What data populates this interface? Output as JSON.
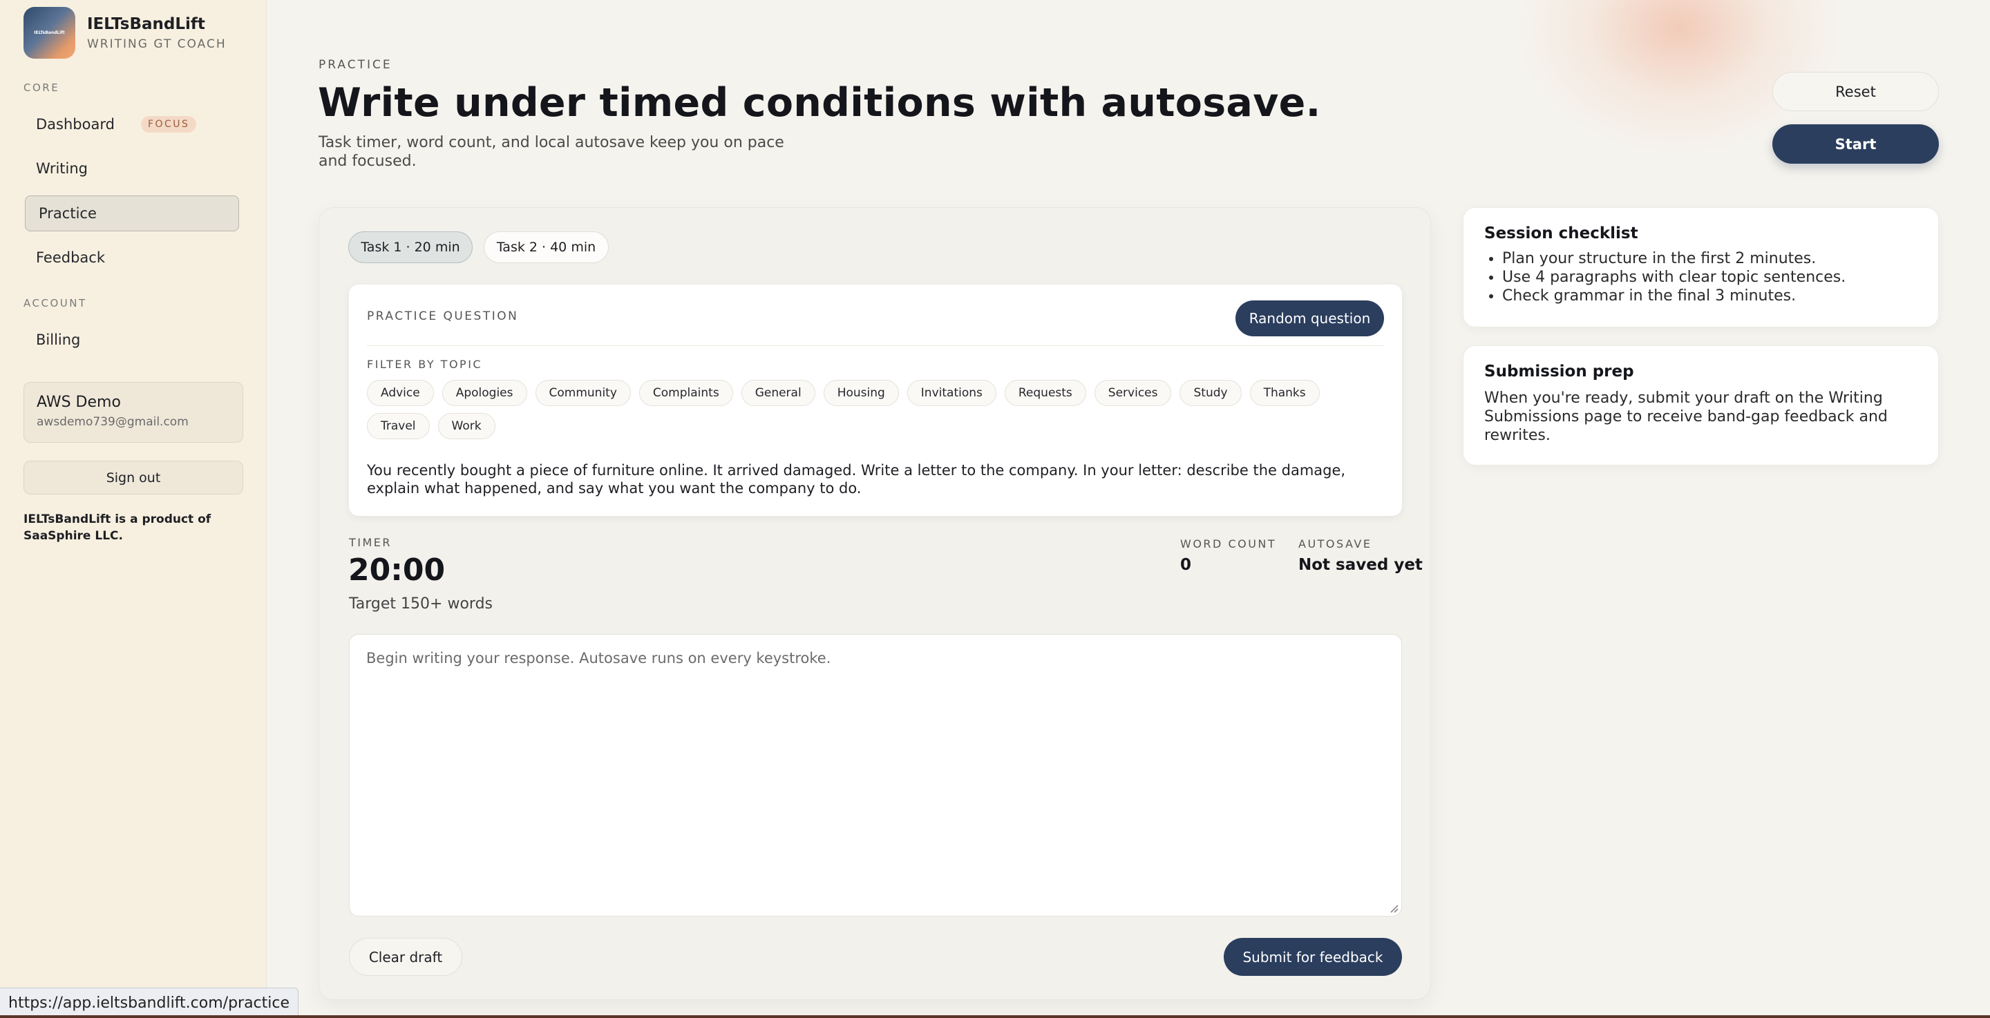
{
  "brand": {
    "name": "IELTsBandLift",
    "subtitle": "WRITING GT COACH",
    "logo_text": "IELTsBandLift"
  },
  "sidebar": {
    "sections": {
      "core": "CORE",
      "account": "ACCOUNT"
    },
    "items": [
      {
        "label": "Dashboard",
        "badge": "FOCUS"
      },
      {
        "label": "Writing"
      },
      {
        "label": "Practice",
        "active": true
      },
      {
        "label": "Feedback"
      },
      {
        "label": "Billing"
      }
    ],
    "user": {
      "name": "AWS Demo",
      "email": "awsdemo739@gmail.com"
    },
    "signout_label": "Sign out",
    "legal": "IELTsBandLift is a product of SaaSphire LLC."
  },
  "header": {
    "eyebrow": "PRACTICE",
    "title": "Write under timed conditions with autosave.",
    "subtitle": "Task timer, word count, and local autosave keep you on pace and focused.",
    "reset_label": "Reset",
    "start_label": "Start"
  },
  "tabs": [
    {
      "label": "Task 1 · 20 min",
      "active": true
    },
    {
      "label": "Task 2 · 40 min",
      "active": false
    }
  ],
  "question": {
    "label": "PRACTICE QUESTION",
    "random_label": "Random question",
    "filter_label": "FILTER BY TOPIC",
    "topics": [
      "Advice",
      "Apologies",
      "Community",
      "Complaints",
      "General",
      "Housing",
      "Invitations",
      "Requests",
      "Services",
      "Study",
      "Thanks",
      "Travel",
      "Work"
    ],
    "text": "You recently bought a piece of furniture online. It arrived damaged. Write a letter to the company. In your letter: describe the damage, explain what happened, and say what you want the company to do."
  },
  "metrics": {
    "timer_label": "TIMER",
    "timer_value": "20:00",
    "target": "Target 150+ words",
    "word_count_label": "WORD COUNT",
    "word_count_value": "0",
    "autosave_label": "AUTOSAVE",
    "autosave_value": "Not saved yet"
  },
  "editor": {
    "placeholder": "Begin writing your response. Autosave runs on every keystroke.",
    "value": ""
  },
  "actions": {
    "clear_label": "Clear draft",
    "submit_label": "Submit for feedback"
  },
  "checklist": {
    "title": "Session checklist",
    "items": [
      "Plan your structure in the first 2 minutes.",
      "Use 4 paragraphs with clear topic sentences.",
      "Check grammar in the final 3 minutes."
    ]
  },
  "submission": {
    "title": "Submission prep",
    "text": "When you're ready, submit your draft on the Writing Submissions page to receive band-gap feedback and rewrites."
  },
  "status_url": "https://app.ieltsbandlift.com/practice",
  "colors": {
    "primary": "#2b3e5e",
    "sidebar_bg": "#f7f0e0",
    "page_bg": "#f5f3ee",
    "badge_text": "#9a5c3a"
  }
}
